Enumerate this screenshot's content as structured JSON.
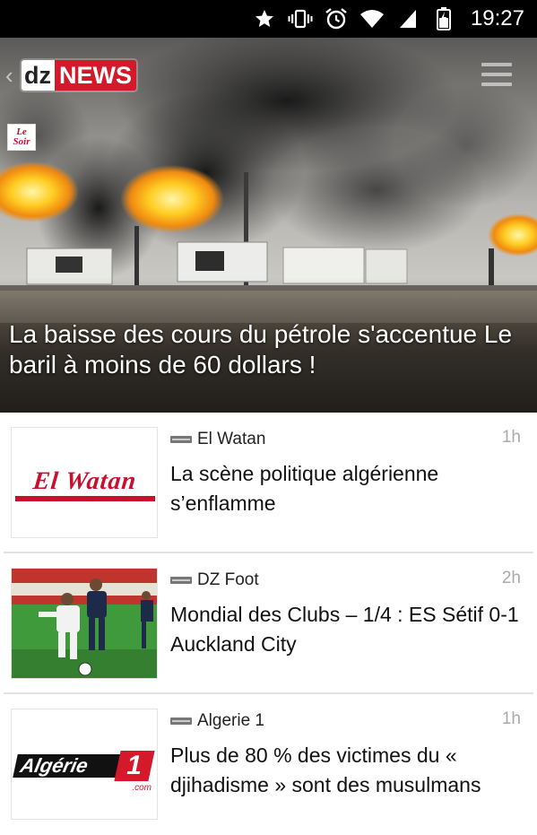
{
  "status_bar": {
    "time": "19:27",
    "icons": [
      "star-icon",
      "vibrate-icon",
      "alarm-icon",
      "wifi-icon",
      "signal-icon",
      "battery-icon"
    ]
  },
  "app_bar": {
    "logo_part1": "dz",
    "logo_part2": "NEWS",
    "brand_color": "#d3192a"
  },
  "hero": {
    "source_badge": "Le Soir",
    "title": "La baisse des cours du pétrole s'accentue Le baril à moins de 60 dollars !"
  },
  "feed": [
    {
      "source": "El Watan",
      "age": "1h",
      "headline": "La scène politique algérienne s’enflamme",
      "thumb_text": "El Watan"
    },
    {
      "source": "DZ Foot",
      "age": "2h",
      "headline": "Mondial des Clubs – 1/4 : ES Sétif 0-1 Auckland City"
    },
    {
      "source": "Algerie 1",
      "age": "1h",
      "headline": "Plus de 80 % des victimes du « djihadisme » sont des musulmans",
      "thumb_text_main": "Algérie",
      "thumb_text_num": "1",
      "thumb_text_suffix": ".com"
    }
  ]
}
